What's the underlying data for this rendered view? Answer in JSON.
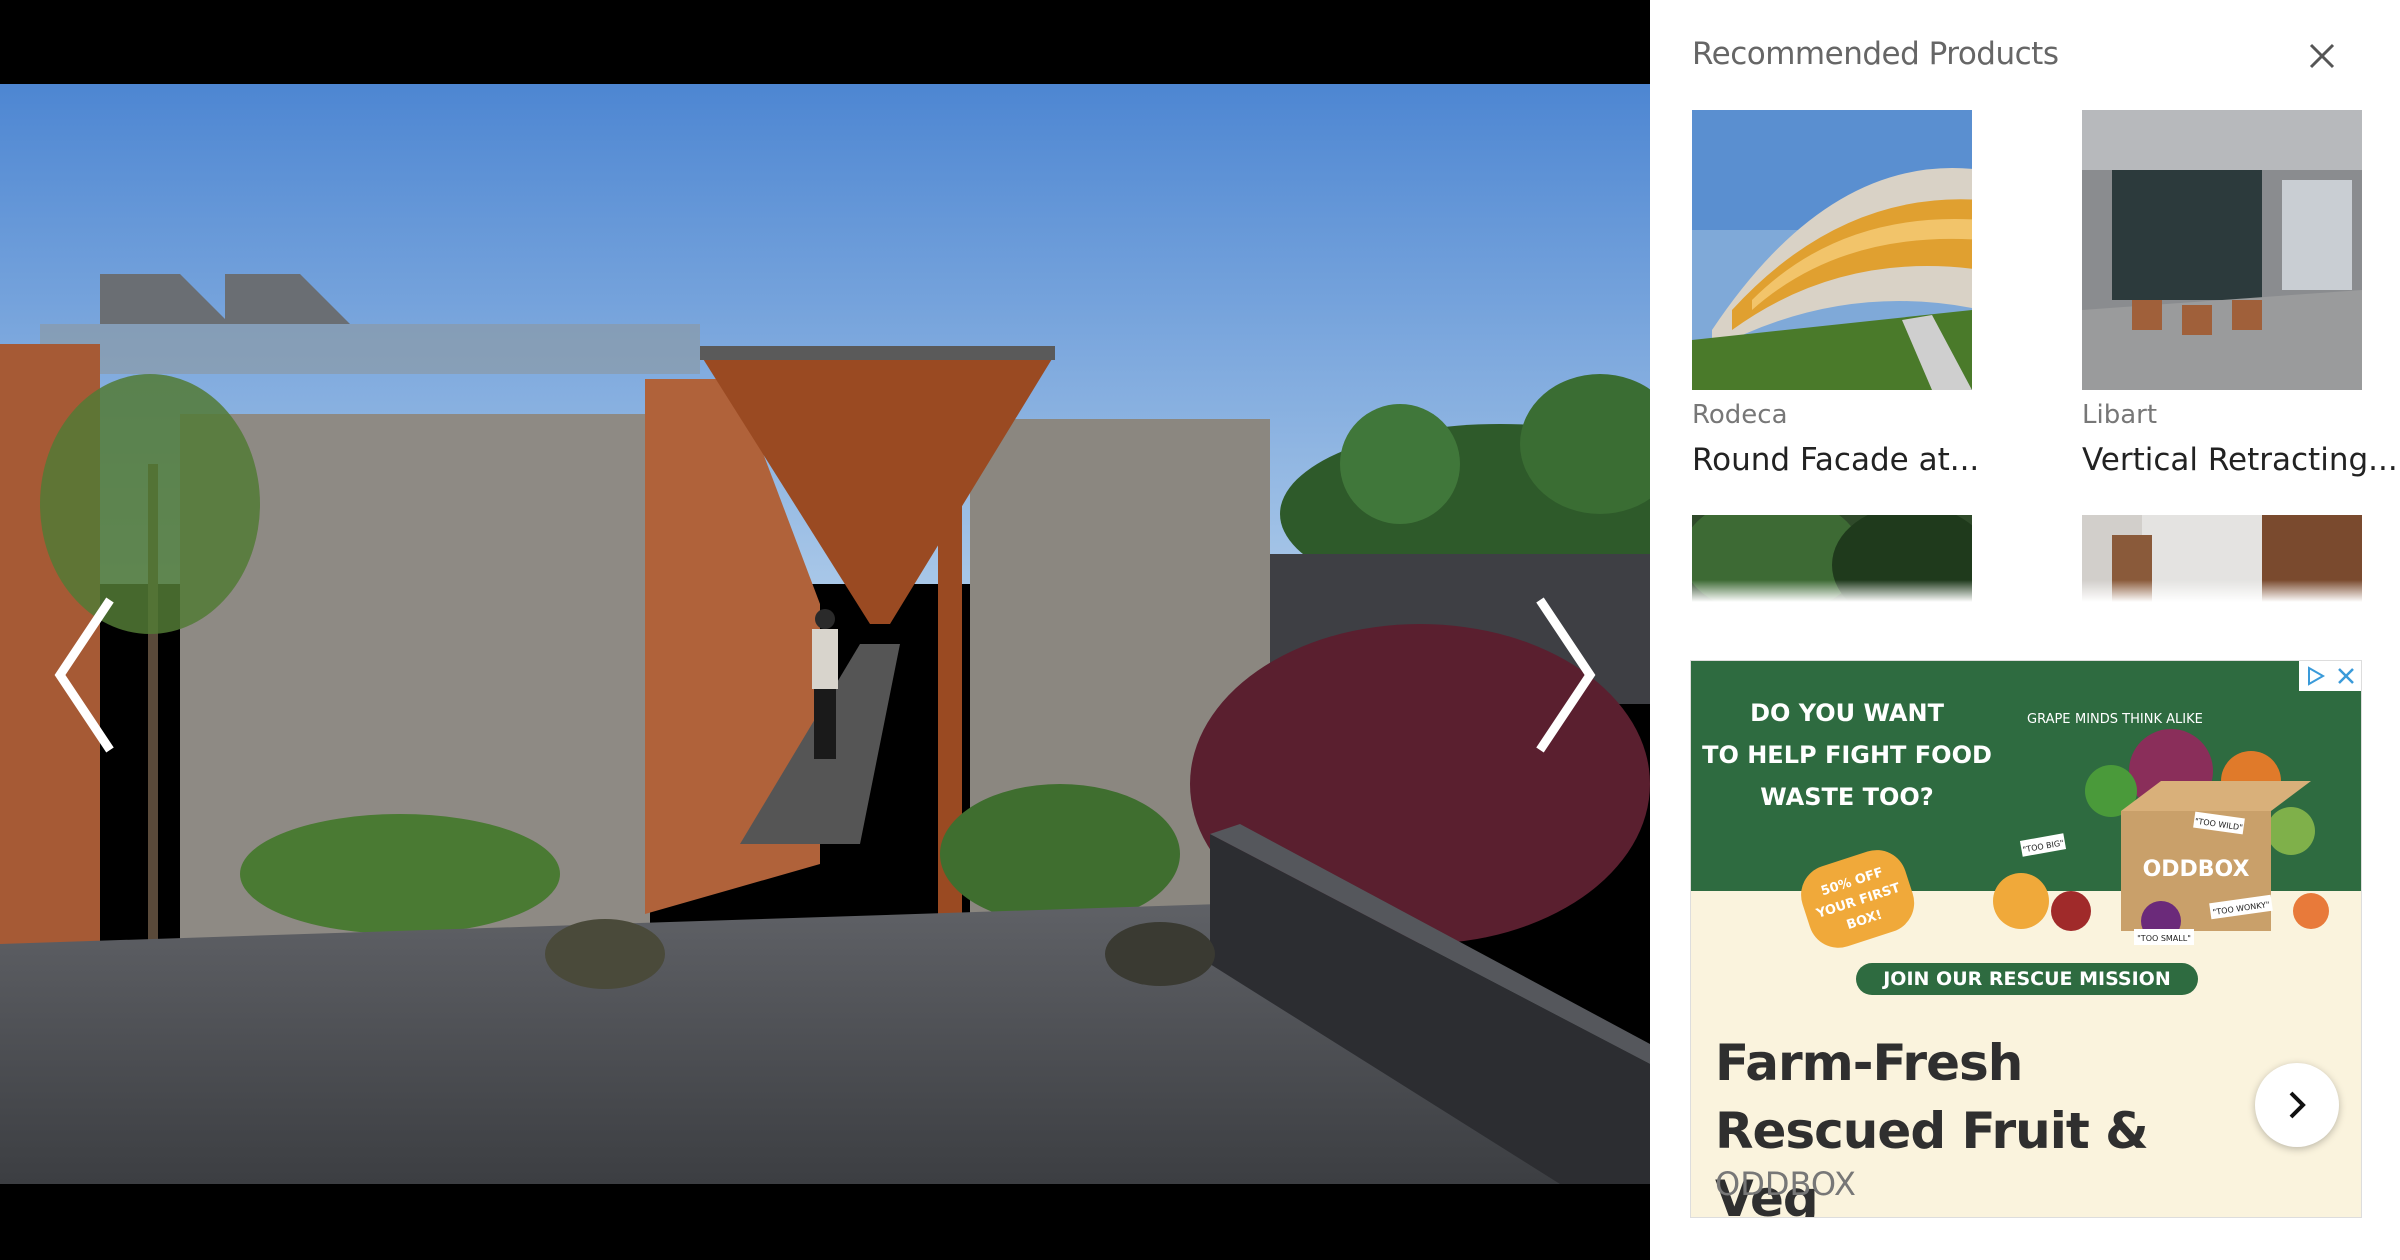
{
  "viewer": {
    "prev_icon": "chevron-left-icon",
    "next_icon": "chevron-right-icon"
  },
  "sidebar": {
    "title": "Recommended Products",
    "close_icon": "close-icon",
    "products": [
      {
        "brand": "Rodeca",
        "name": "Round Facade at..."
      },
      {
        "brand": "Libart",
        "name": "Vertical Retracting..."
      },
      {
        "brand": "",
        "name": ""
      },
      {
        "brand": "",
        "name": ""
      }
    ]
  },
  "ad": {
    "banner": {
      "line1": "DO YOU WANT",
      "line2": "TO HELP FIGHT FOOD",
      "line3": "WASTE TOO?",
      "tagline_a": "GRAPE",
      "tagline_b": " MINDS THINK ALIKE",
      "sticker1": "50% OFF",
      "sticker2": "YOUR FIRST",
      "sticker3": "BOX!",
      "box_label": "ODDBOX",
      "tag1": "\"TOO BIG\"",
      "tag2": "\"TOO WILD\"",
      "tag3": "\"TOO SMALL\"",
      "tag4": "\"TOO WONKY\"",
      "button": "JOIN OUR RESCUE MISSION"
    },
    "headline": "Farm-Fresh Rescued Fruit & Veg",
    "brand": "ODDBOX",
    "colors": {
      "green": "#2e6b40",
      "cream": "#faf3dd",
      "orange": "#f0a93a"
    }
  }
}
